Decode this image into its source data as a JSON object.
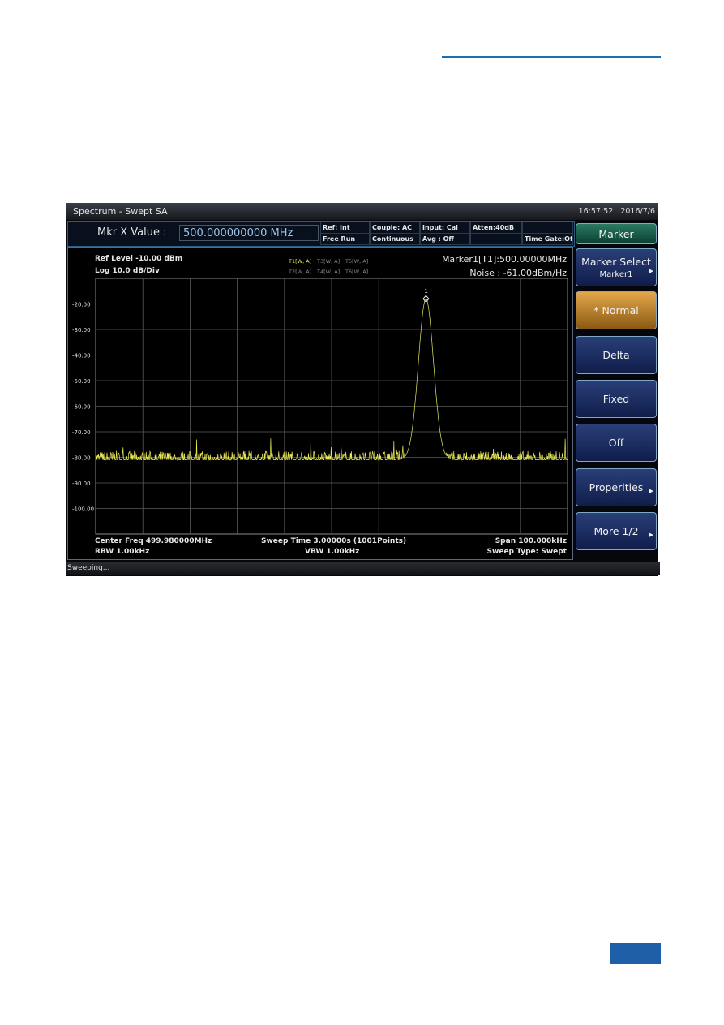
{
  "window": {
    "title": "Spectrum - Swept SA",
    "time": "16:57:52",
    "date": "2016/7/6"
  },
  "info": {
    "mkr_label": "Mkr X Value :",
    "mkr_value": "500.000000000 MHz",
    "cells": [
      [
        "Ref: Int",
        "Free Run"
      ],
      [
        "Couple: AC",
        "Continuous"
      ],
      [
        "Input: Cal",
        "Avg : Off"
      ],
      [
        "Atten:40dB",
        ""
      ],
      [
        "",
        "Time Gate:Off"
      ]
    ]
  },
  "plot": {
    "ref_level": "Ref Level -10.00 dBm",
    "scale": "Log 10.0 dB/Div",
    "traces_row1": [
      "T1[W, A]",
      "T3[W, A]",
      "T5[W, A]"
    ],
    "traces_row2": [
      "T2[W, A]",
      "T4[W, A]",
      "T6[W, A]"
    ],
    "marker_readout": "Marker1[T1]:500.00000MHz",
    "noise_readout": "Noise : -61.00dBm/Hz",
    "marker_label": "1",
    "center_freq": "Center Freq 499.980000MHz",
    "sweep_time": "Sweep Time 3.00000s  (1001Points)",
    "span": "Span 100.000kHz",
    "rbw": "RBW 1.00kHz",
    "vbw": "VBW 1.00kHz",
    "sweep_type": "Sweep Type: Swept"
  },
  "chart_data": {
    "type": "line",
    "ylim": [
      -110,
      -10
    ],
    "xlim_MHz": [
      499.93,
      500.03
    ],
    "y_ticks": [
      "-20.00",
      "-30.00",
      "-40.00",
      "-50.00",
      "-60.00",
      "-70.00",
      "-80.00",
      "-90.00",
      "-100.00"
    ],
    "grid": true,
    "series": [
      {
        "color": "#e8e85a",
        "noise_floor_dBm": -81,
        "peak": {
          "x_MHz": 500.0,
          "y_dBm": -18
        }
      }
    ],
    "marker": {
      "x_MHz": 500.0,
      "y_dBm": -18
    }
  },
  "softkeys": {
    "header": "Marker",
    "items": [
      {
        "label": "Marker Select",
        "sub": "Marker1",
        "arrow": true
      },
      {
        "label": "* Normal",
        "active": true
      },
      {
        "label": "Delta"
      },
      {
        "label": "Fixed"
      },
      {
        "label": "Off"
      },
      {
        "label": "Properities",
        "arrow": true
      },
      {
        "label": "More 1/2",
        "arrow": true
      }
    ]
  },
  "status": "Sweeping..."
}
